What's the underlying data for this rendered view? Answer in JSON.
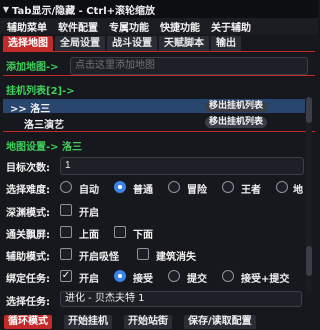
{
  "window": {
    "title": "Tab显示/隐藏 - Ctrl+滚轮缩放"
  },
  "menu": {
    "items": [
      "辅助菜单",
      "软件配置",
      "专属功能",
      "快捷功能",
      "关于辅助"
    ]
  },
  "tabs": [
    "选择地图",
    "全局设置",
    "战斗设置",
    "天赋脚本",
    "输出"
  ],
  "add_map": {
    "label": "添加地图->",
    "placeholder": "点击这里添加地图"
  },
  "hang_list": {
    "label": "挂机列表[2]->",
    "items": [
      {
        "name": ">> 洛三",
        "button": "移出挂机列表"
      },
      {
        "name": "洛三演艺",
        "button": "移出挂机列表"
      }
    ]
  },
  "map_settings": {
    "label": "地图设置-> 洛三"
  },
  "target_count": {
    "label": "目标次数:",
    "value": "1"
  },
  "difficulty": {
    "label": "选择难度:",
    "options": [
      "自动",
      "普通",
      "冒险",
      "王者",
      "地"
    ],
    "selected": "普通"
  },
  "abyss": {
    "label": "深渊模式:",
    "option": "开启"
  },
  "clear_sky": {
    "label": "通关飘屏:",
    "options": [
      "上面",
      "下面"
    ]
  },
  "assist": {
    "label": "辅助模式:",
    "options": [
      "开启吸怪",
      "建筑消失"
    ]
  },
  "bind_task": {
    "label": "绑定任务:",
    "check": "开启",
    "options": [
      "接受",
      "提交",
      "接受+提交"
    ],
    "selected": "接受"
  },
  "select_task": {
    "label": "选择任务:",
    "value": "进化 - 贝杰夫特 1"
  },
  "bottom": {
    "buttons": [
      "循环模式",
      "开始挂机",
      "开始站街",
      "保存/读取配置"
    ]
  }
}
